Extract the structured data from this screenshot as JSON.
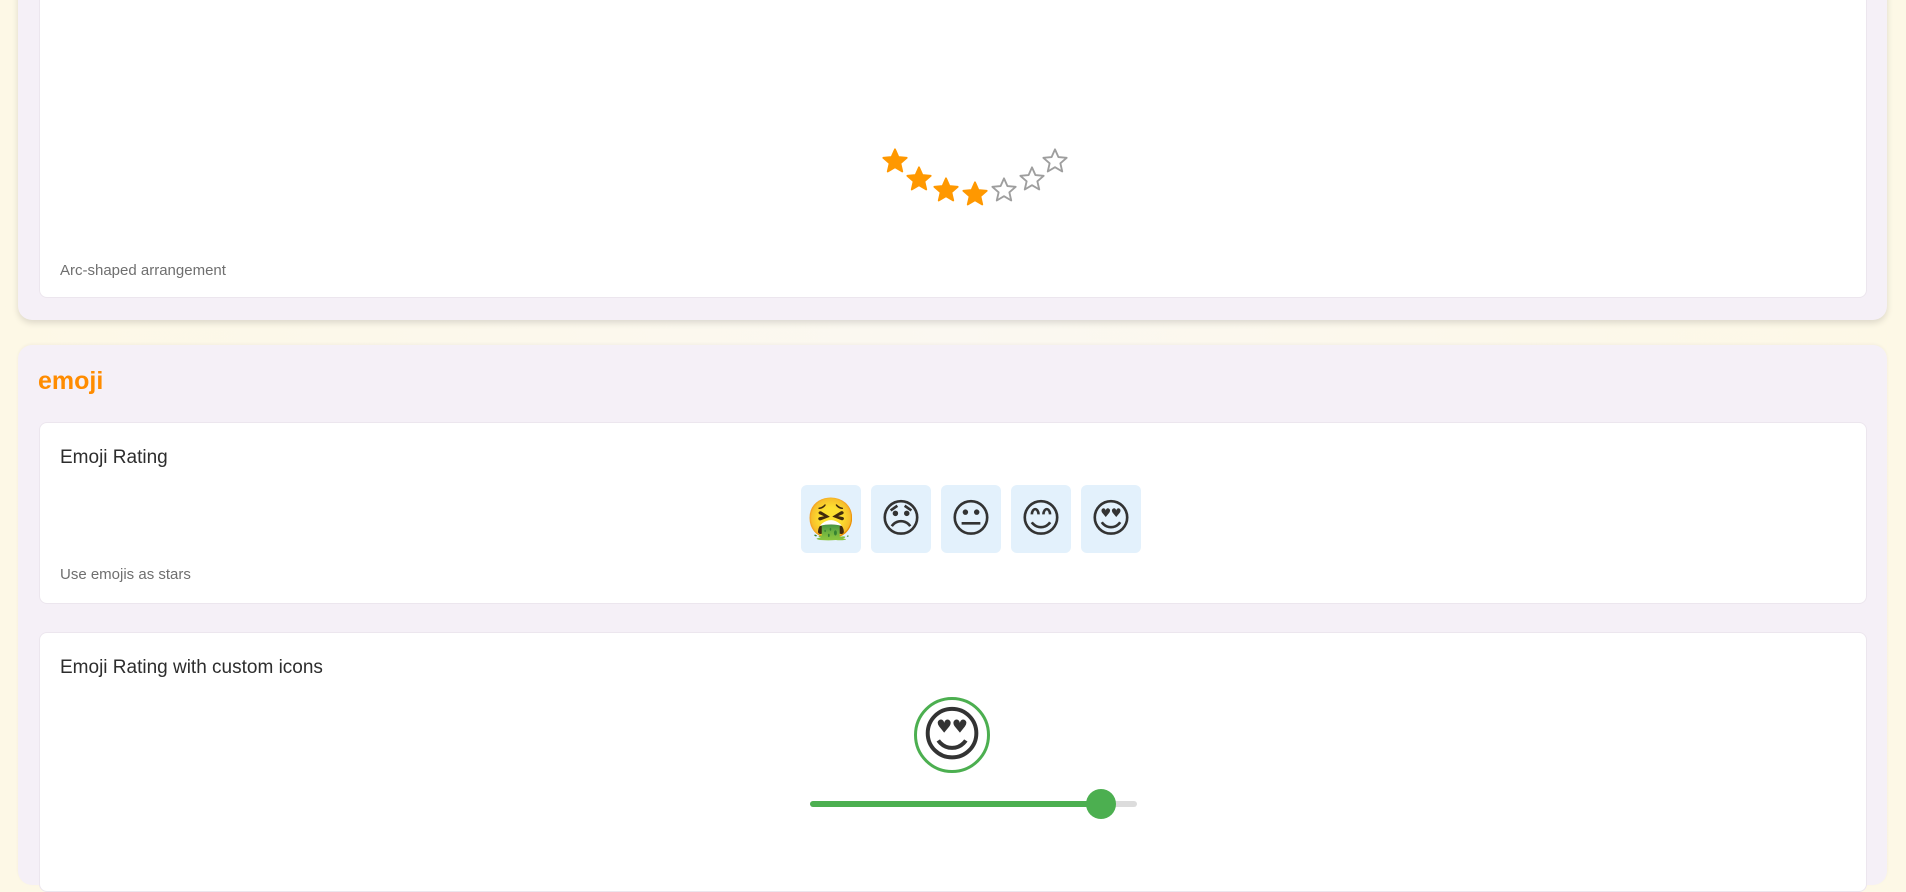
{
  "colors": {
    "accent": "#ff8c00",
    "star_filled": "#ff9800",
    "star_empty": "#9e9e9e",
    "slider": "#4caf50",
    "emoji_bg": "#e3f1fc"
  },
  "arc_demo": {
    "caption": "Arc-shaped arrangement",
    "stars": [
      {
        "icon": "star-outline-icon",
        "filled": false
      },
      {
        "icon": "star-outline-icon",
        "filled": false
      },
      {
        "icon": "star-outline-icon",
        "filled": false
      },
      {
        "icon": "star-filled-icon",
        "filled": true
      },
      {
        "icon": "star-filled-icon",
        "filled": true
      },
      {
        "icon": "star-filled-icon",
        "filled": true
      },
      {
        "icon": "star-filled-icon",
        "filled": true
      }
    ]
  },
  "emoji_section": {
    "title": "emoji",
    "emoji_rating": {
      "title": "Emoji Rating",
      "caption": "Use emojis as stars",
      "options": [
        {
          "glyph": "🤮",
          "icon": "nauseated-face-icon"
        },
        {
          "glyph": "😞",
          "icon": "disappointed-face-icon"
        },
        {
          "glyph": "😐",
          "icon": "neutral-face-icon"
        },
        {
          "glyph": "😊",
          "icon": "smiling-face-icon"
        },
        {
          "glyph": "😍",
          "icon": "heart-eyes-face-icon"
        }
      ]
    },
    "custom_icons": {
      "title": "Emoji Rating with custom icons",
      "current_emoji": "😍",
      "current_icon": "heart-eyes-face-icon",
      "slider_value": 0.89
    }
  }
}
